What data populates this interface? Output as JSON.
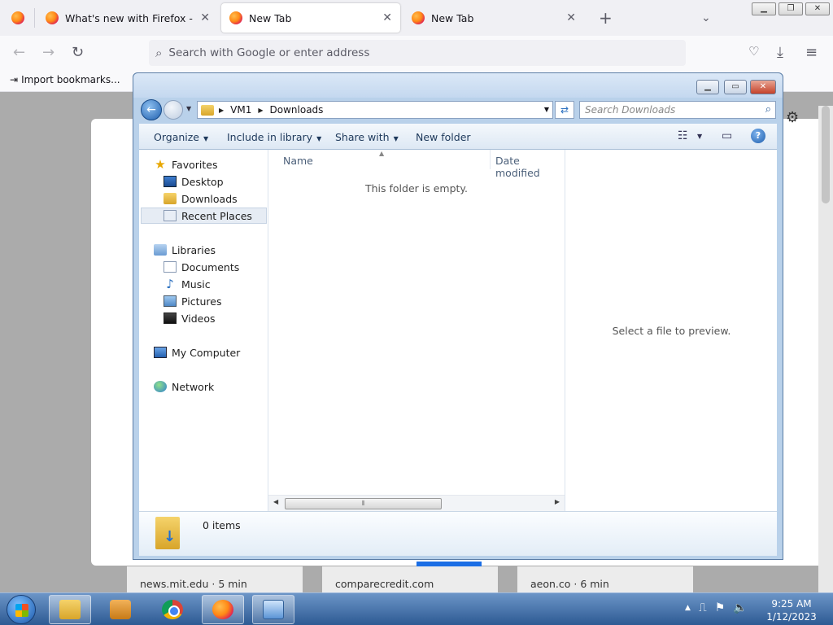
{
  "browser": {
    "tabs": [
      {
        "label": "What's new with Firefox - More",
        "active": false
      },
      {
        "label": "New Tab",
        "active": true
      },
      {
        "label": "New Tab",
        "active": false
      }
    ],
    "new_tab_symbol": "+",
    "url_placeholder": "Search with Google or enter address",
    "bookmark_item": "Import bookmarks...",
    "newtab_tiles": [
      "news.mit.edu · 5 min",
      "comparecredit.com",
      "aeon.co · 6 min"
    ]
  },
  "explorer": {
    "breadcrumb": [
      "VM1",
      "Downloads"
    ],
    "search_placeholder": "Search Downloads",
    "commands": {
      "organize": "Organize",
      "include_in_library": "Include in library",
      "share_with": "Share with",
      "new_folder": "New folder"
    },
    "nav": {
      "favorites": "Favorites",
      "desktop": "Desktop",
      "downloads": "Downloads",
      "recent_places": "Recent Places",
      "libraries": "Libraries",
      "documents": "Documents",
      "music": "Music",
      "pictures": "Pictures",
      "videos": "Videos",
      "my_computer": "My Computer",
      "network": "Network"
    },
    "selected_nav": "recent_places",
    "columns": {
      "name": "Name",
      "date_modified": "Date modified"
    },
    "empty_message": "This folder is empty.",
    "preview_message": "Select a file to preview.",
    "status_count": "0 items"
  },
  "taskbar": {
    "time": "9:25 AM",
    "date": "1/12/2023"
  },
  "colors": {
    "accent_blue": "#1b6ee5",
    "explorer_frame": "#b9d1ea",
    "taskbar": "#2d5a93"
  }
}
